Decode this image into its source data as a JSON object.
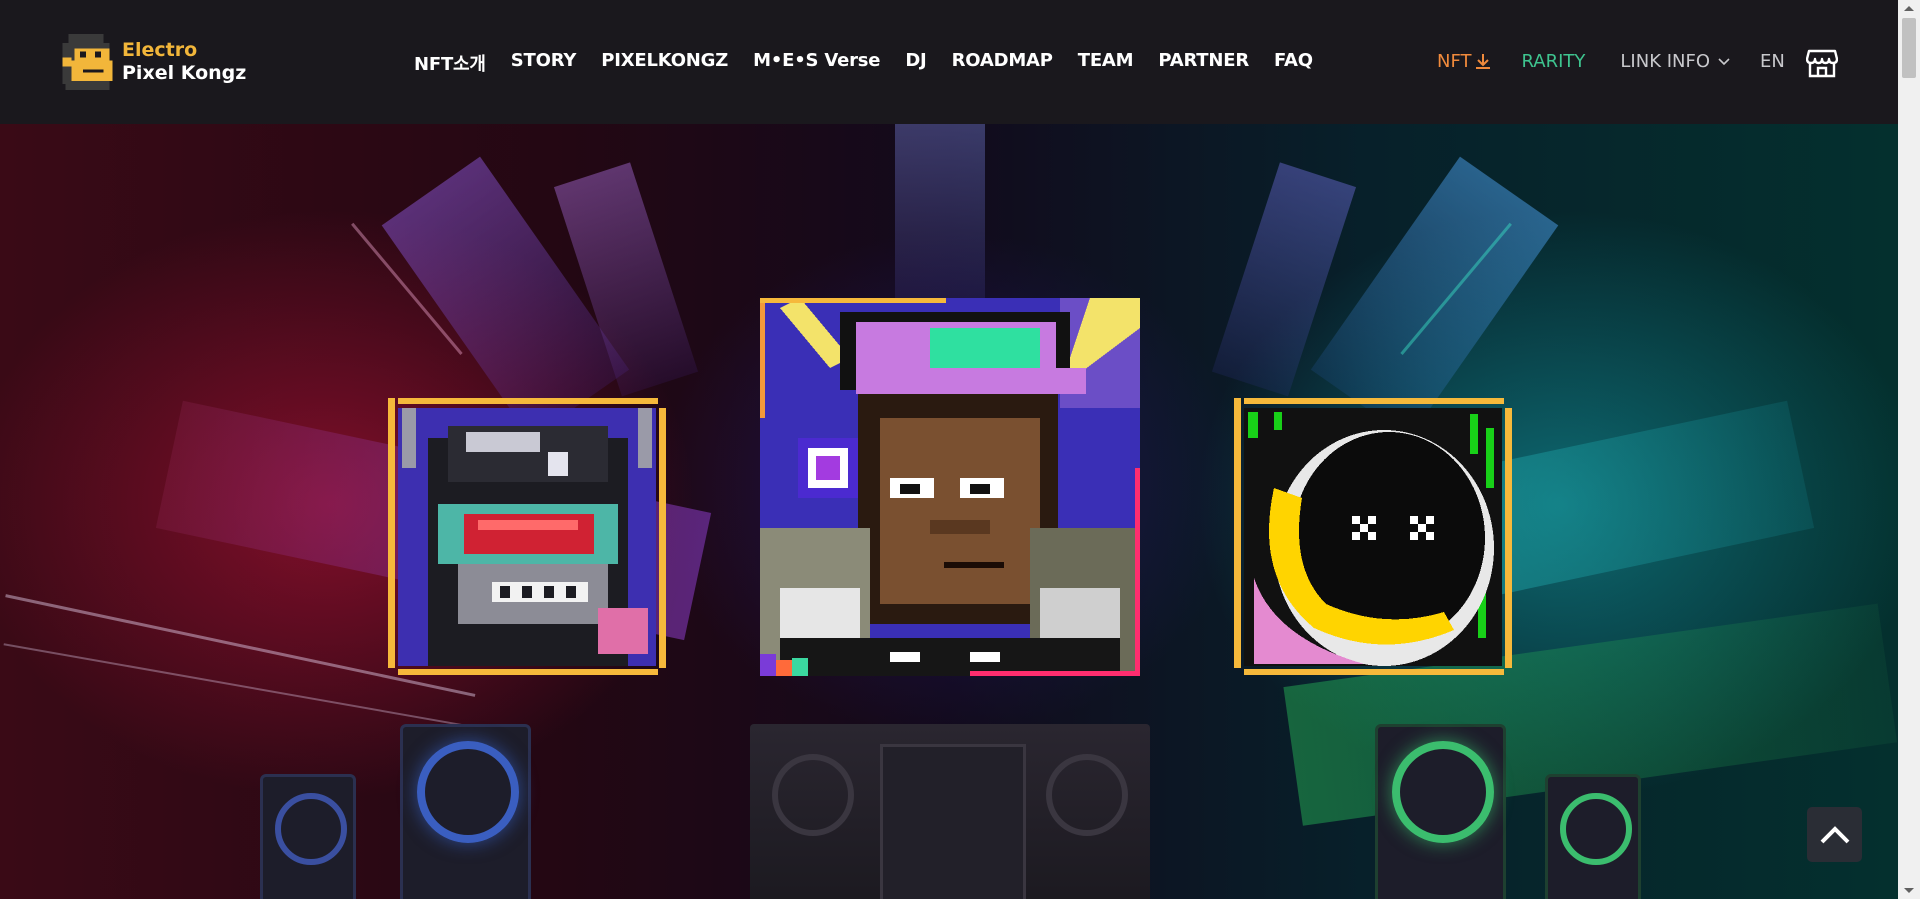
{
  "logo": {
    "line1": "Electro",
    "line2": "Pixel Kongz",
    "icon": "kong-logo-icon"
  },
  "nav": {
    "items": [
      "NFT소개",
      "STORY",
      "PIXELKONGZ",
      "M•E•S Verse",
      "DJ",
      "ROADMAP",
      "TEAM",
      "PARTNER",
      "FAQ"
    ]
  },
  "right_nav": {
    "nft_download": "NFT",
    "rarity": "RARITY",
    "link_info": "LINK INFO",
    "language": "EN",
    "icons": [
      "download-icon",
      "chevron-down-icon",
      "store-icon"
    ]
  },
  "hero": {
    "cards": [
      {
        "name": "goggles-kong-nft",
        "frame_color": "#f6b93b"
      },
      {
        "name": "dj-kong-nft",
        "frame_color": "#f6b93b"
      },
      {
        "name": "astronaut-kong-nft",
        "frame_color": "#f6b93b"
      }
    ]
  },
  "controls": {
    "scroll_top_icon": "chevron-up-icon"
  },
  "colors": {
    "header_bg": "#1a181d",
    "nft_accent": "#f08a3c",
    "rarity_accent": "#3ec48f",
    "logo_accent": "#f2b63a"
  }
}
